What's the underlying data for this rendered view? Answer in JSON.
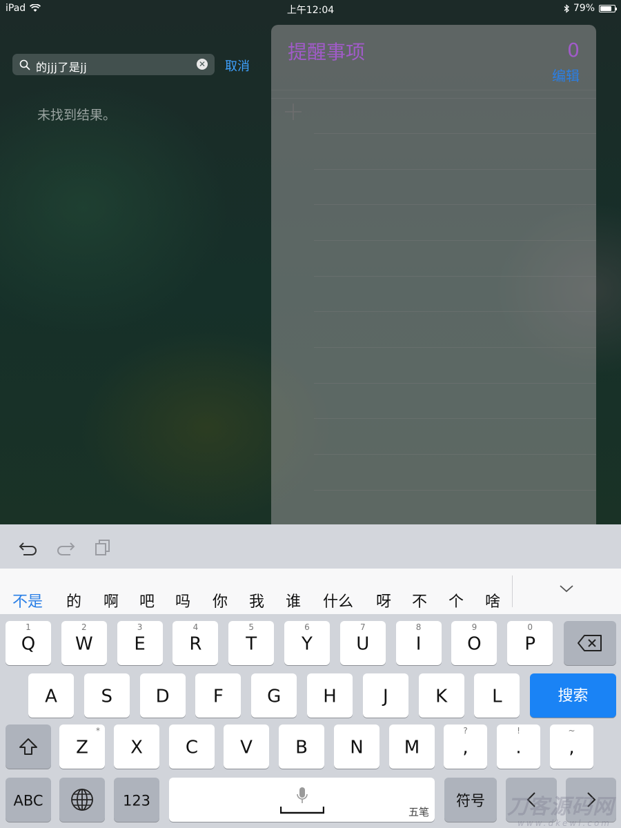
{
  "status_bar": {
    "device": "iPad",
    "time": "上午12:04",
    "battery": "79%",
    "battery_level": 0.79
  },
  "search": {
    "query": "的jjj了是jj",
    "cancel_label": "取消",
    "no_results": "未找到结果。"
  },
  "widget": {
    "title": "提醒事项",
    "count": "0",
    "edit_label": "编辑"
  },
  "candidates": [
    "不是",
    "的",
    "啊",
    "吧",
    "吗",
    "你",
    "我",
    "谁",
    "什么",
    "呀",
    "不",
    "个",
    "啥"
  ],
  "keyboard": {
    "row1": [
      {
        "label": "Q",
        "hint": "1"
      },
      {
        "label": "W",
        "hint": "2"
      },
      {
        "label": "E",
        "hint": "3"
      },
      {
        "label": "R",
        "hint": "4"
      },
      {
        "label": "T",
        "hint": "5"
      },
      {
        "label": "Y",
        "hint": "6"
      },
      {
        "label": "U",
        "hint": "7"
      },
      {
        "label": "I",
        "hint": "8"
      },
      {
        "label": "O",
        "hint": "9"
      },
      {
        "label": "P",
        "hint": "0"
      }
    ],
    "row2": [
      "A",
      "S",
      "D",
      "F",
      "G",
      "H",
      "J",
      "K",
      "L"
    ],
    "search_label": "搜索",
    "row3": [
      {
        "label": "Z",
        "hint": "*"
      },
      {
        "label": "X",
        "hint": ""
      },
      {
        "label": "C",
        "hint": ""
      },
      {
        "label": "V",
        "hint": ""
      },
      {
        "label": "B",
        "hint": ""
      },
      {
        "label": "N",
        "hint": ""
      },
      {
        "label": "M",
        "hint": ""
      },
      {
        "label": ",",
        "hint": "?"
      },
      {
        "label": ".",
        "hint": "!"
      },
      {
        "label": ",",
        "hint": "~"
      }
    ],
    "abc_label": "ABC",
    "num_label": "123",
    "space_sub": "五笔",
    "symbol_label": "符号"
  },
  "watermark": {
    "text": "刀客源码网",
    "url": "www.dkewl.com"
  }
}
